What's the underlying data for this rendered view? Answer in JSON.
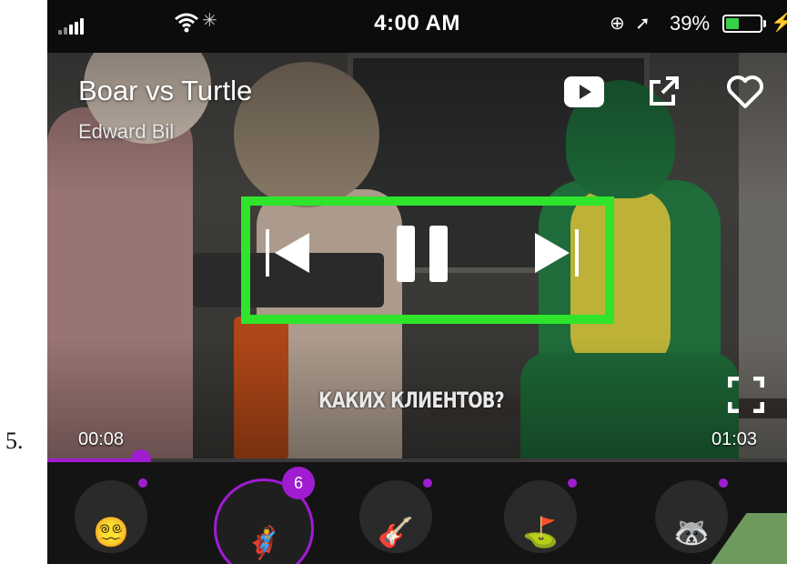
{
  "step_label": "5.",
  "status_bar": {
    "time": "4:00 AM",
    "battery_percent": "39%",
    "battery_level": 0.39,
    "icons": [
      "signal-icon",
      "wifi-icon",
      "activity-spinner-icon",
      "orientation-lock-icon",
      "location-icon",
      "battery-icon",
      "charging-icon"
    ]
  },
  "video": {
    "title": "Boar vs Turtle",
    "author": "Edward Bil",
    "subtitle": "КАКИХ КЛИЕНТОВ?",
    "current_time": "00:08",
    "total_time": "01:03",
    "progress": 0.127,
    "top_icons": [
      "youtube-icon",
      "share-icon",
      "heart-icon"
    ],
    "controls": [
      "previous-track-icon",
      "pause-icon",
      "next-track-icon"
    ],
    "highlight_color": "#2fe52c"
  },
  "tray": {
    "accent_color": "#a01cd1",
    "chips": [
      {
        "emoji": "😵‍💫",
        "name": "dizzy-face-icon",
        "selected": false
      },
      {
        "emoji": "🦸‍♂️",
        "name": "superhero-icon",
        "selected": true,
        "badge": "6"
      },
      {
        "emoji": "🎸",
        "name": "guitar-icon",
        "selected": false
      },
      {
        "emoji": "⛳",
        "name": "golf-flag-icon",
        "selected": false
      },
      {
        "emoji": "🦝",
        "name": "raccoon-icon",
        "selected": false
      }
    ]
  }
}
